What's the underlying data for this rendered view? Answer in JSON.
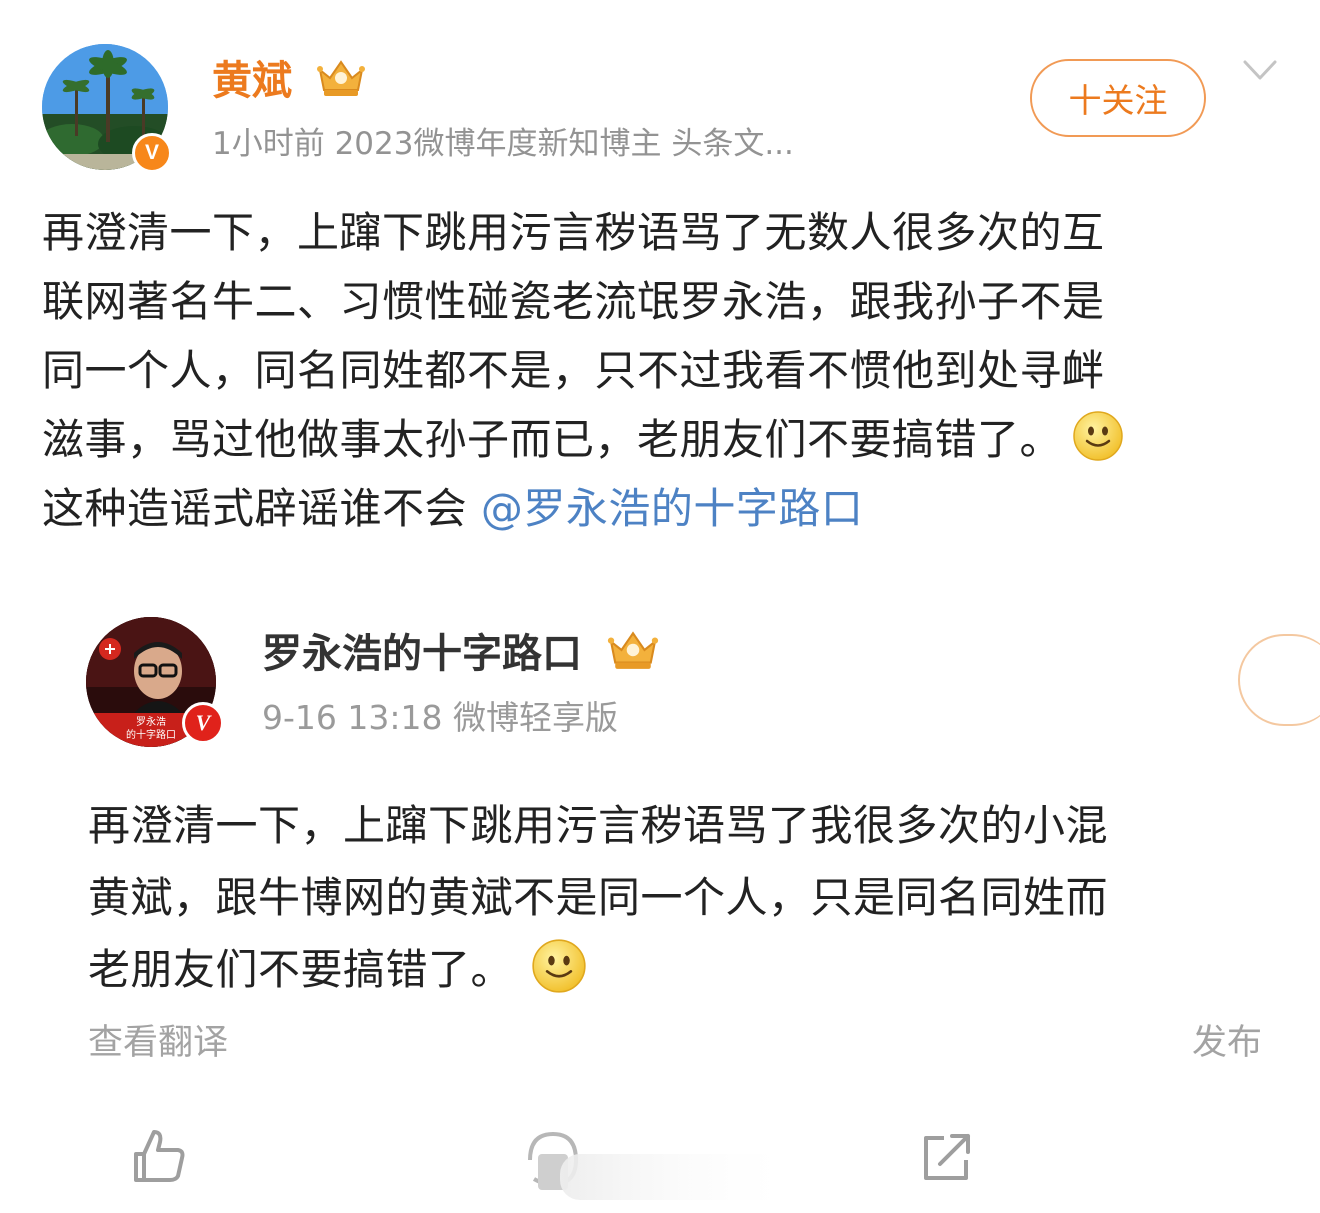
{
  "post": {
    "author": {
      "name": "黄斌",
      "verified_badge": "V",
      "crown_icon": "member-crown-icon"
    },
    "meta": "1小时前  2023微博年度新知博主 头条文...",
    "follow_button": "十关注",
    "text_lines": [
      "再澄清一下，上蹿下跳用污言秽语骂了无数人很多次的互",
      "联网著名牛二、习惯性碰瓷老流氓罗永浩，跟我孙子不是",
      "同一个人，同名同姓都不是，只不过我看不惯他到处寻衅",
      "滋事，骂过他做事太孙子而已，老朋友们不要搞错了。",
      "这种造谣式辟谣谁不会"
    ],
    "mention": "@罗永浩的十字路口",
    "emoji": "smile-emoji"
  },
  "quoted": {
    "author": {
      "name": "罗永浩的十字路口",
      "verified_badge": "V",
      "avatar_caption_1": "罗永浩",
      "avatar_caption_2": "的十字路口"
    },
    "meta": "9-16 13:18   微博轻享版",
    "text_lines": [
      "再澄清一下，上蹿下跳用污言秽语骂了我很多次的小混",
      "黄斌，跟牛博网的黄斌不是同一个人，只是同名同姓而",
      "老朋友们不要搞错了。"
    ],
    "translate_link": "查看翻译",
    "publish_label": "发布"
  },
  "actions": [
    "like-icon",
    "comment-icon",
    "share-icon"
  ],
  "colors": {
    "accent_orange": "#ec7a1e",
    "mention_blue": "#4d82c4",
    "verified_orange": "#f7871a",
    "verified_red": "#e0221b",
    "muted_gray": "#939393"
  }
}
